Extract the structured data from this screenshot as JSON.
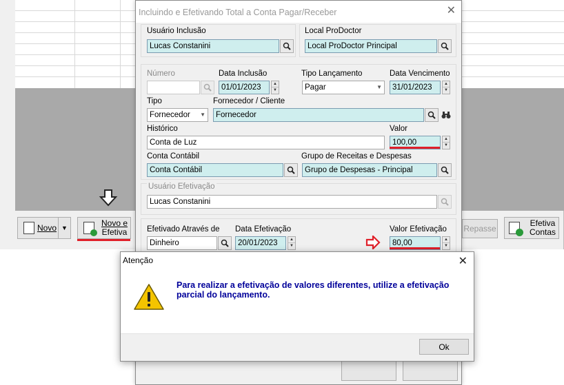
{
  "background": {
    "novo_label": "Novo",
    "novo_efetiva_label_line1": "Novo e",
    "novo_efetiva_label_line2": "Efetiva",
    "repasse_label": "Repasse",
    "efetiva_contas_line1": "Efetiva",
    "efetiva_contas_line2": "Contas",
    "accent_color": "#e0202a"
  },
  "dialog": {
    "title": "Incluindo e Efetivando Total a Conta Pagar/Receber",
    "usuario_inclusao_label": "Usuário Inclusão",
    "usuario_inclusao_value": "Lucas Constanini",
    "local_label": "Local ProDoctor",
    "local_value": "Local ProDoctor Principal",
    "numero_label": "Número",
    "numero_value": "",
    "data_inclusao_label": "Data Inclusão",
    "data_inclusao_value": "01/01/2023",
    "tipo_lancamento_label": "Tipo Lançamento",
    "tipo_lancamento_value": "Pagar",
    "data_vencimento_label": "Data Vencimento",
    "data_vencimento_value": "31/01/2023",
    "tipo_label": "Tipo",
    "tipo_value": "Fornecedor",
    "fornecedor_label": "Fornecedor / Cliente",
    "fornecedor_value": "Fornecedor",
    "historico_label": "Histórico",
    "historico_value": "Conta de Luz",
    "valor_label": "Valor",
    "valor_value": "100,00",
    "conta_contabil_label": "Conta Contábil",
    "conta_contabil_value": "Conta Contábil",
    "grupo_label": "Grupo de Receitas e Despesas",
    "grupo_value": "Grupo de Despesas - Principal",
    "usuario_efetivacao_label": "Usuário Efetivação",
    "usuario_efetivacao_value": "Lucas Constanini",
    "efetivado_atraves_label": "Efetivado Através de",
    "efetivado_atraves_value": "Dinheiro",
    "data_efetivacao_label": "Data Efetivação",
    "data_efetivacao_value": "20/01/2023",
    "valor_efetivacao_label": "Valor Efetivação",
    "valor_efetivacao_value": "80,00"
  },
  "alert": {
    "title": "Atenção",
    "message": "Para realizar a efetivação de valores diferentes, utilize a efetivação parcial do lançamento.",
    "ok_label": "Ok",
    "icon": "warning-icon"
  }
}
